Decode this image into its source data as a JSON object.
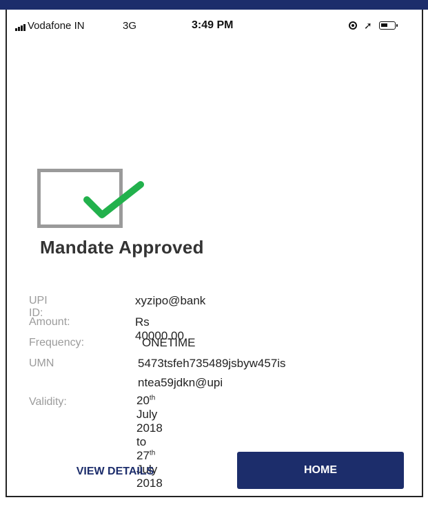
{
  "status_bar": {
    "carrier": "Vodafone IN",
    "network": "3G",
    "time": "3:49 PM",
    "icons": [
      "signal-icon",
      "rotation-lock-icon",
      "location-icon",
      "battery-icon"
    ]
  },
  "result": {
    "icon": "success-check-icon",
    "title": "Mandate Approved"
  },
  "details": {
    "upi_label": "UPI ID:",
    "upi_value": "xyzipo@bank",
    "amount_label": "Amount:",
    "amount_value": "Rs 40000.00",
    "frequency_label": "Frequency:",
    "frequency_value": "ONETIME",
    "umn_label": "UMN",
    "umn_value_line1": "5473tsfeh735489jsbyw457is",
    "umn_value_line2": "ntea59jdkn@upi",
    "validity_label": "Validity:",
    "validity_from_day": "20",
    "validity_from_sup": "th",
    "validity_from_rest": " July 2018 to ",
    "validity_to_day": "27",
    "validity_to_sup": "th",
    "validity_to_rest": " July 2018"
  },
  "actions": {
    "view_details": "VIEW DETAILS",
    "home": "HOME"
  },
  "colors": {
    "brand": "#1c2d6b",
    "success": "#22b14c",
    "label": "#9b9b9b"
  }
}
